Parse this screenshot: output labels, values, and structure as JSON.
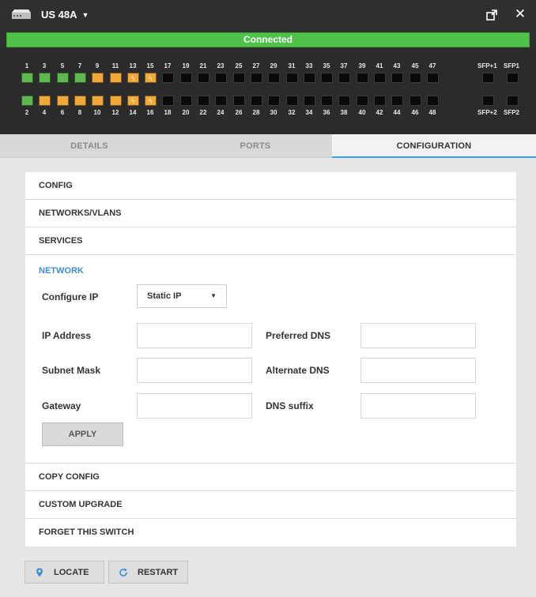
{
  "titlebar": {
    "device_name": "US 48A",
    "close_glyph": "✕"
  },
  "status": {
    "text": "Connected"
  },
  "ports": {
    "top_numbers": [
      "1",
      "3",
      "5",
      "7",
      "9",
      "11",
      "13",
      "15",
      "17",
      "19",
      "21",
      "23",
      "25",
      "27",
      "29",
      "31",
      "33",
      "35",
      "37",
      "39",
      "41",
      "43",
      "45",
      "47"
    ],
    "bottom_numbers": [
      "2",
      "4",
      "6",
      "8",
      "10",
      "12",
      "14",
      "16",
      "18",
      "20",
      "22",
      "24",
      "26",
      "28",
      "30",
      "32",
      "34",
      "36",
      "38",
      "40",
      "42",
      "44",
      "46",
      "48"
    ],
    "top_states": [
      "green",
      "green",
      "green",
      "green",
      "orange",
      "orange",
      "orange-poe",
      "orange-poe",
      "black",
      "black",
      "black",
      "black",
      "black",
      "black",
      "black",
      "black",
      "black",
      "black",
      "black",
      "black",
      "black",
      "black",
      "black",
      "black"
    ],
    "bottom_states": [
      "green",
      "orange",
      "orange",
      "orange",
      "orange",
      "orange",
      "orange-poe",
      "orange-poe",
      "black",
      "black",
      "black",
      "black",
      "black",
      "black",
      "black",
      "black",
      "black",
      "black",
      "black",
      "black",
      "black",
      "black",
      "black",
      "black"
    ],
    "sfp_top_labels": [
      "SFP+1",
      "SFP1"
    ],
    "sfp_bottom_labels": [
      "SFP+2",
      "SFP2"
    ],
    "colors": {
      "green": "#5fb84f",
      "orange": "#f0a83a",
      "black": "#0a0a0a"
    }
  },
  "tabs": [
    {
      "label": "DETAILS",
      "active": false
    },
    {
      "label": "PORTS",
      "active": false
    },
    {
      "label": "CONFIGURATION",
      "active": true
    }
  ],
  "sections": {
    "config": "CONFIG",
    "networks_vlans": "NETWORKS/VLANS",
    "services": "SERVICES",
    "network": "NETWORK",
    "copy_config": "COPY CONFIG",
    "custom_upgrade": "CUSTOM UPGRADE",
    "forget_switch": "FORGET THIS SWITCH"
  },
  "network_form": {
    "configure_ip_label": "Configure IP",
    "configure_ip_value": "Static IP",
    "ip_address_label": "IP Address",
    "subnet_mask_label": "Subnet Mask",
    "gateway_label": "Gateway",
    "preferred_dns_label": "Preferred DNS",
    "alternate_dns_label": "Alternate DNS",
    "dns_suffix_label": "DNS suffix",
    "ip_address_value": "",
    "subnet_mask_value": "",
    "gateway_value": "",
    "preferred_dns_value": "",
    "alternate_dns_value": "",
    "dns_suffix_value": "",
    "apply_label": "APPLY"
  },
  "footer": {
    "locate_label": "LOCATE",
    "restart_label": "RESTART",
    "accent_color": "#3a8dd6"
  }
}
